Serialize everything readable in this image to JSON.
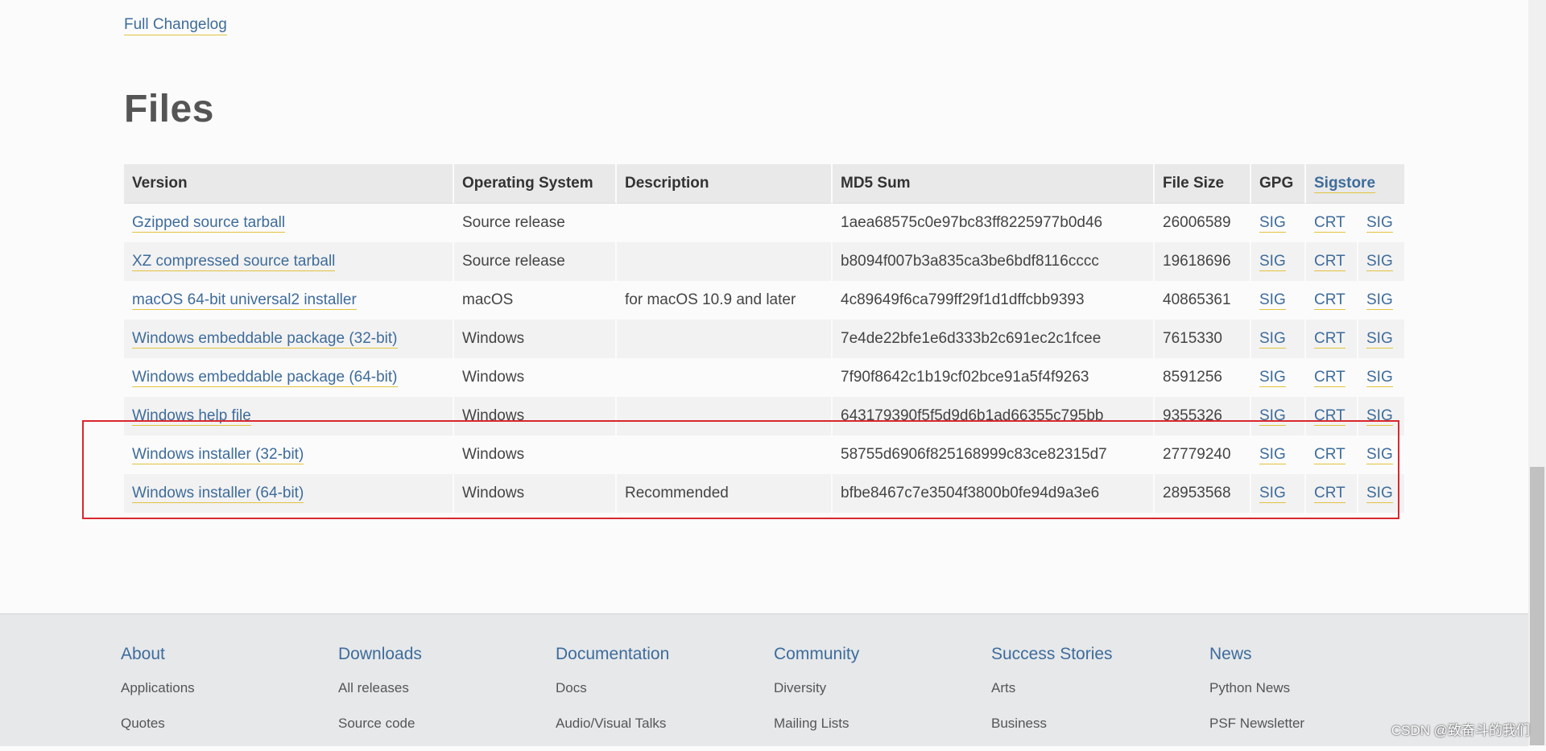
{
  "changelog_link": "Full Changelog",
  "files_title": "Files",
  "table": {
    "headers": {
      "version": "Version",
      "os": "Operating System",
      "description": "Description",
      "md5": "MD5 Sum",
      "size": "File Size",
      "gpg": "GPG",
      "sigstore": "Sigstore"
    },
    "rows": [
      {
        "version": "Gzipped source tarball",
        "os": "Source release",
        "description": "",
        "md5": "1aea68575c0e97bc83ff8225977b0d46",
        "size": "26006589",
        "gpg": "SIG",
        "crt": "CRT",
        "sig": "SIG"
      },
      {
        "version": "XZ compressed source tarball",
        "os": "Source release",
        "description": "",
        "md5": "b8094f007b3a835ca3be6bdf8116cccc",
        "size": "19618696",
        "gpg": "SIG",
        "crt": "CRT",
        "sig": "SIG"
      },
      {
        "version": "macOS 64-bit universal2 installer",
        "os": "macOS",
        "description": "for macOS 10.9 and later",
        "md5": "4c89649f6ca799ff29f1d1dffcbb9393",
        "size": "40865361",
        "gpg": "SIG",
        "crt": "CRT",
        "sig": "SIG"
      },
      {
        "version": "Windows embeddable package (32-bit)",
        "os": "Windows",
        "description": "",
        "md5": "7e4de22bfe1e6d333b2c691ec2c1fcee",
        "size": "7615330",
        "gpg": "SIG",
        "crt": "CRT",
        "sig": "SIG"
      },
      {
        "version": "Windows embeddable package (64-bit)",
        "os": "Windows",
        "description": "",
        "md5": "7f90f8642c1b19cf02bce91a5f4f9263",
        "size": "8591256",
        "gpg": "SIG",
        "crt": "CRT",
        "sig": "SIG"
      },
      {
        "version": "Windows help file",
        "os": "Windows",
        "description": "",
        "md5": "643179390f5f5d9d6b1ad66355c795bb",
        "size": "9355326",
        "gpg": "SIG",
        "crt": "CRT",
        "sig": "SIG"
      },
      {
        "version": "Windows installer (32-bit)",
        "os": "Windows",
        "description": "",
        "md5": "58755d6906f825168999c83ce82315d7",
        "size": "27779240",
        "gpg": "SIG",
        "crt": "CRT",
        "sig": "SIG"
      },
      {
        "version": "Windows installer (64-bit)",
        "os": "Windows",
        "description": "Recommended",
        "md5": "bfbe8467c7e3504f3800b0fe94d9a3e6",
        "size": "28953568",
        "gpg": "SIG",
        "crt": "CRT",
        "sig": "SIG"
      }
    ]
  },
  "footer": {
    "columns": [
      {
        "heading": "About",
        "links": [
          "Applications",
          "Quotes"
        ]
      },
      {
        "heading": "Downloads",
        "links": [
          "All releases",
          "Source code"
        ]
      },
      {
        "heading": "Documentation",
        "links": [
          "Docs",
          "Audio/Visual Talks"
        ]
      },
      {
        "heading": "Community",
        "links": [
          "Diversity",
          "Mailing Lists"
        ]
      },
      {
        "heading": "Success Stories",
        "links": [
          "Arts",
          "Business"
        ]
      },
      {
        "heading": "News",
        "links": [
          "Python News",
          "PSF Newsletter"
        ]
      }
    ]
  },
  "watermark": "CSDN @致奋斗的我们",
  "colors": {
    "link": "#3e6c9b",
    "highlight_border": "#d9272e",
    "underline": "#e2c33d"
  }
}
